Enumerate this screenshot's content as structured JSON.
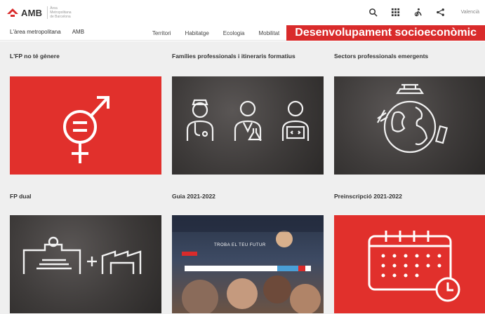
{
  "header": {
    "logo_text": "AMB",
    "logo_subtitle": "Àrea Metropolitana de Barcelona",
    "language": "Valencià",
    "icons": [
      "search-icon",
      "grid-icon",
      "accessibility-icon",
      "share-icon"
    ]
  },
  "nav": {
    "left": [
      "L'àrea metropolitana",
      "AMB"
    ],
    "right": [
      "Territori",
      "Habitatge",
      "Ecologia",
      "Mobilitat"
    ],
    "active": "Desenvolupament socioeconòmic"
  },
  "cards": [
    {
      "title": "L'FP no té gènere",
      "style": "red",
      "icon": "gender-equality-icon"
    },
    {
      "title": "Famílies professionals i itineraris formatius",
      "style": "board",
      "icon": "professionals-icon"
    },
    {
      "title": "Sectors professionals emergents",
      "style": "board",
      "icon": "globe-icon"
    },
    {
      "title": "FP dual",
      "style": "board",
      "icon": "school-industry-icon"
    },
    {
      "title": "Guia 2021-2022",
      "style": "photo",
      "icon": "students-photo",
      "hero_text": "TROBA EL TEU FUTUR"
    },
    {
      "title": "Preinscripció 2021-2022",
      "style": "red",
      "icon": "calendar-icon"
    }
  ],
  "colors": {
    "accent": "#d92b2b",
    "card_red": "#e1302c",
    "background": "#efefef"
  }
}
